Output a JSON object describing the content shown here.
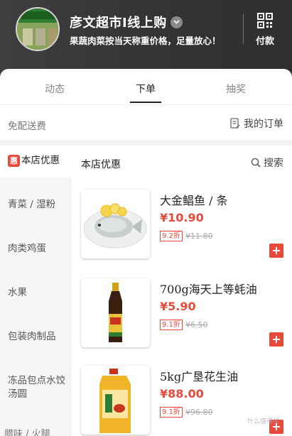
{
  "header": {
    "store_name": "彦文超市I线上购",
    "slogan": "果蔬肉菜按当天称重价格，足量放心！",
    "pay_label": "付款",
    "avatar_sign_text": "彦文超市"
  },
  "tabs": [
    {
      "label": "动态",
      "active": false
    },
    {
      "label": "下单",
      "active": true
    },
    {
      "label": "抽奖",
      "active": false
    }
  ],
  "subbar": {
    "free_delivery": "免配送费",
    "my_orders": "我的订单"
  },
  "sidebar": {
    "active_badge": "惠",
    "items": [
      {
        "label": "本店优惠",
        "active": true
      },
      {
        "label": "青菜 / 湿粉",
        "active": false
      },
      {
        "label": "肉类鸡蛋",
        "active": false
      },
      {
        "label": "水果",
        "active": false
      },
      {
        "label": "包装肉制品",
        "active": false
      },
      {
        "label": "冻品包点水饺汤圆",
        "active": false
      }
    ],
    "partial_item": "腊味 / 火腿"
  },
  "content": {
    "section_title": "本店优惠",
    "search_label": "搜索"
  },
  "products": [
    {
      "name": "大金鲳鱼 / 条",
      "price": "¥10.90",
      "discount": "9.2折",
      "original_price": "¥11.80"
    },
    {
      "name": "700g海天上等蚝油",
      "price": "¥5.90",
      "discount": "9.1折",
      "original_price": "¥6.50"
    },
    {
      "name": "5kg广垦花生油",
      "price": "¥88.00",
      "discount": "9.1折",
      "original_price": "¥96.80"
    }
  ],
  "watermark": "什么值得买",
  "colors": {
    "accent": "#e74a3b",
    "header_bg": "#3b3b3b"
  }
}
